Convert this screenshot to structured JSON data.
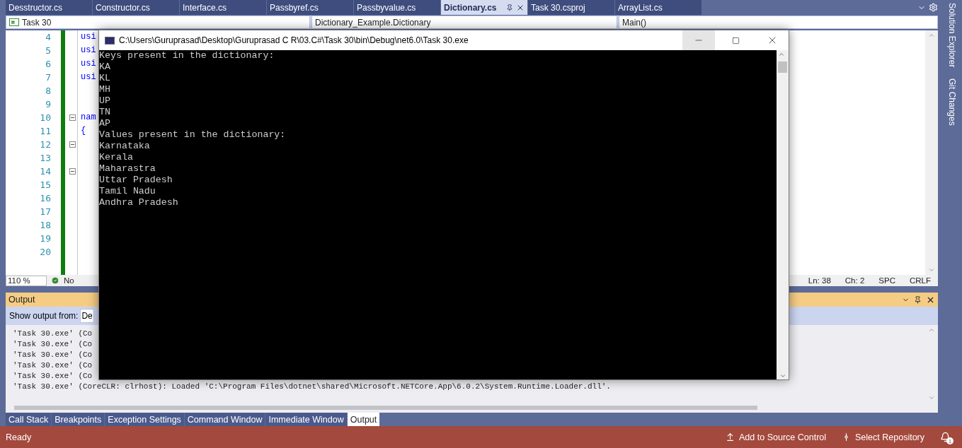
{
  "tabs": [
    {
      "label": "Desstructor.cs",
      "selected": false
    },
    {
      "label": "Constructor.cs",
      "selected": false
    },
    {
      "label": "Interface.cs",
      "selected": false
    },
    {
      "label": "Passbyref.cs",
      "selected": false
    },
    {
      "label": "Passbyvalue.cs",
      "selected": false
    },
    {
      "label": "Dictionary.cs",
      "selected": true
    },
    {
      "label": "Task 30.csproj",
      "selected": false
    },
    {
      "label": "ArrayList.cs",
      "selected": false
    }
  ],
  "side_tabs": [
    "Solution Explorer",
    "Git Changes"
  ],
  "nav_bar": {
    "project": "Task 30",
    "type": "Dictionary_Example.Dictionary",
    "member": "Main()"
  },
  "editor": {
    "lines": [
      {
        "number": "4",
        "code": "usi",
        "fold": false
      },
      {
        "number": "5",
        "code": "usi",
        "fold": false
      },
      {
        "number": "6",
        "code": "usi",
        "fold": false
      },
      {
        "number": "7",
        "code": "usi",
        "fold": false
      },
      {
        "number": "8",
        "fold": false
      },
      {
        "number": "9",
        "fold": false
      },
      {
        "number": "10",
        "code": "nam",
        "fold": true
      },
      {
        "number": "11",
        "code": "{",
        "fold": false
      },
      {
        "number": "12",
        "fold": true
      },
      {
        "number": "13",
        "fold": false
      },
      {
        "number": "14",
        "fold": true
      },
      {
        "number": "15",
        "fold": false
      },
      {
        "number": "16",
        "fold": false
      },
      {
        "number": "17",
        "fold": false
      },
      {
        "number": "18",
        "fold": false
      },
      {
        "number": "19",
        "fold": false
      },
      {
        "number": "20",
        "fold": false
      }
    ]
  },
  "editor_status": {
    "zoom": "110 %",
    "issues": "No",
    "line": "Ln: 38",
    "column": "Ch: 2",
    "indent": "SPC",
    "line_ending": "CRLF"
  },
  "output": {
    "title": "Output",
    "source_label": "Show output from:",
    "source": "De",
    "lines": [
      "'Task 30.exe' (Co",
      "'Task 30.exe' (Co",
      "'Task 30.exe' (Co",
      "'Task 30.exe' (Co",
      "'Task 30.exe' (Co",
      "'Task 30.exe' (CoreCLR: clrhost): Loaded 'C:\\Program Files\\dotnet\\shared\\Microsoft.NETCore.App\\6.0.2\\System.Runtime.Loader.dll'."
    ]
  },
  "bottom_tabs": [
    {
      "label": "Call Stack",
      "selected": false
    },
    {
      "label": "Breakpoints",
      "selected": false
    },
    {
      "label": "Exception Settings",
      "selected": false
    },
    {
      "label": "Command Window",
      "selected": false
    },
    {
      "label": "Immediate Window",
      "selected": false
    },
    {
      "label": "Output",
      "selected": true
    }
  ],
  "status_bar": {
    "state": "Ready",
    "source_control": "Add to Source Control",
    "repository": "Select Repository",
    "notifications": "1"
  },
  "console": {
    "title": "C:\\Users\\Guruprasad\\Desktop\\Guruprasad C R\\03.C#\\Task 30\\bin\\Debug\\net6.0\\Task 30.exe",
    "lines": [
      "Keys present in the dictionary:",
      "KA",
      "KL",
      "MH",
      "UP",
      "TN",
      "AP",
      "Values present in the dictionary:",
      "Karnataka",
      "Kerala",
      "Maharastra",
      "Uttar Pradesh",
      "Tamil Nadu",
      "Andhra Pradesh"
    ]
  }
}
